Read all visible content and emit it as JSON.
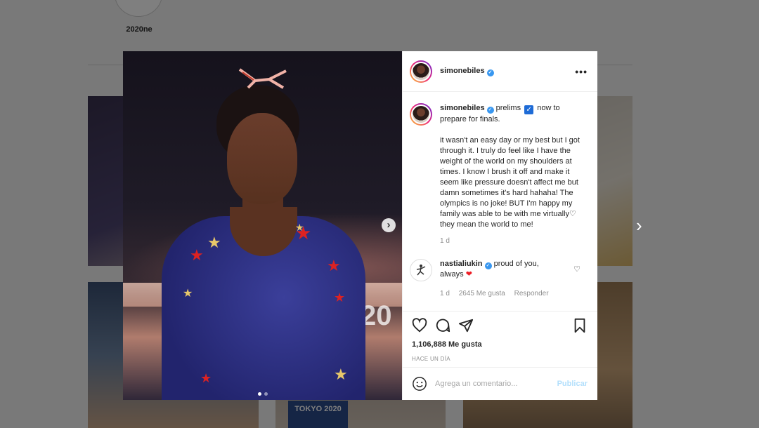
{
  "profile": {
    "highlight_label": "2020ne"
  },
  "background": {
    "tokyo_sign": "TOKYO 2020",
    "next_post_glyph": "›"
  },
  "post": {
    "image_number_text": "20",
    "carousel_next_glyph": "›",
    "carousel": {
      "count": 2,
      "active_index": 0
    },
    "author": "simonebiles",
    "more_glyph": "•••",
    "caption": {
      "username": "simonebiles",
      "text_before_check": "prelims",
      "text_after_check": "now to prepare for finals.",
      "body": "it wasn't an easy day or my best but I got through it. I truly do feel like I have the weight of the world on my shoulders at times. I know I brush it off and make it seem like pressure doesn't affect me but damn sometimes it's hard hahaha! The olympics is no joke! BUT I'm happy my family was able to be with me virtually♡ they mean the world to me!",
      "age": "1 d"
    },
    "comments": [
      {
        "username": "nastialiukin",
        "text": "proud of you, always",
        "emoji": "❤",
        "age": "1 d",
        "likes": "2645 Me gusta",
        "reply": "Responder"
      }
    ],
    "likes_text": "1,106,888 Me gusta",
    "time_ago": "HACE UN DÍA",
    "comment_placeholder": "Agrega un comentario...",
    "publish_label": "Publicar"
  }
}
